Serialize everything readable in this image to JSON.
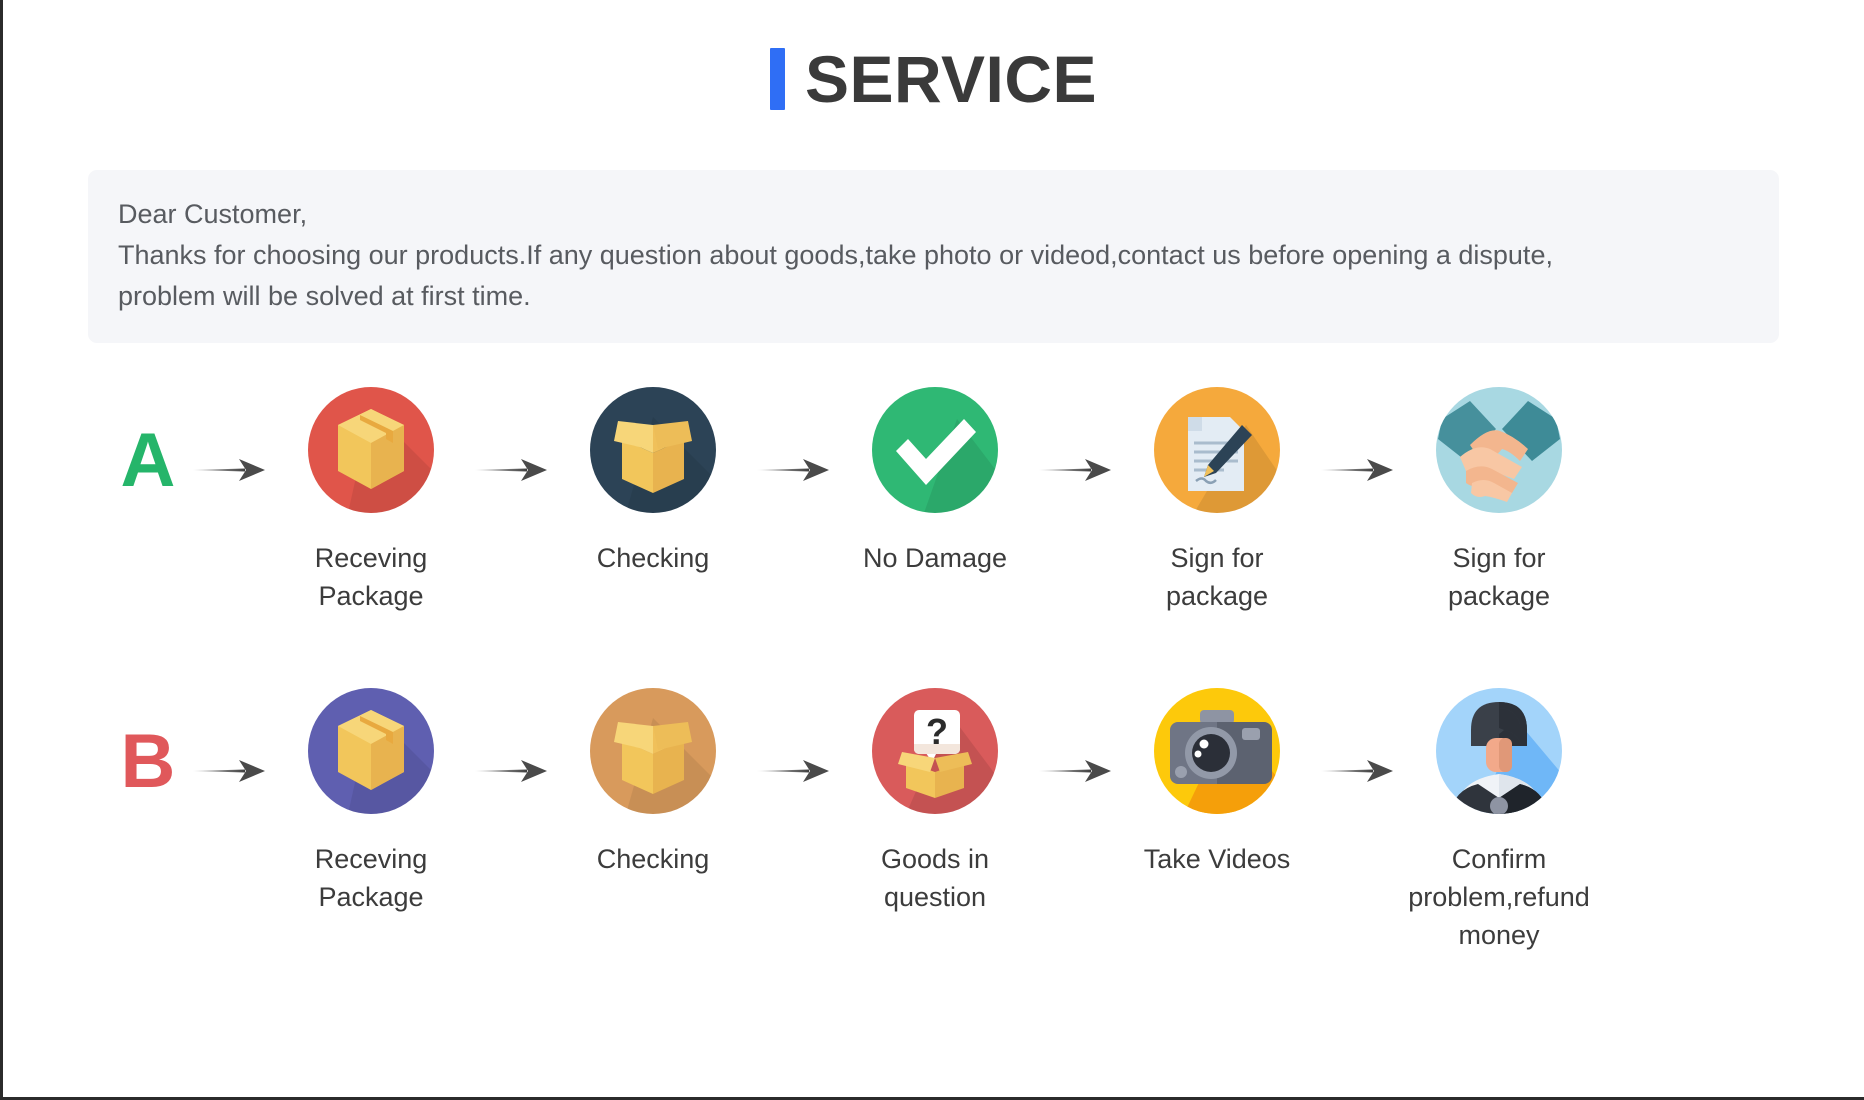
{
  "header": {
    "accent_color": "#2f6ef5",
    "title": "SERVICE"
  },
  "notice": {
    "line1": "Dear Customer,",
    "line2": "Thanks for choosing our products.If any question about goods,take photo or videod,contact us before opening a dispute,",
    "line3": "problem will be solved at first time.",
    "background": "#f5f6f9"
  },
  "flows": [
    {
      "letter": "A",
      "letter_color": "#25b56a",
      "steps": [
        {
          "icon": "package-box-icon",
          "circle": "#e0554a",
          "label": "Receving Package"
        },
        {
          "icon": "open-box-icon",
          "circle": "#2c4356",
          "label": "Checking"
        },
        {
          "icon": "checkmark-icon",
          "circle": "#2fb874",
          "label": "No Damage"
        },
        {
          "icon": "document-pen-icon",
          "circle": "#f5a93c",
          "label": "Sign for package"
        },
        {
          "icon": "handshake-icon",
          "circle": "#a8d8e2",
          "label": "Sign for package"
        }
      ]
    },
    {
      "letter": "B",
      "letter_color": "#e0585b",
      "steps": [
        {
          "icon": "package-box-icon",
          "circle": "#5f5fb0",
          "label": "Receving Package"
        },
        {
          "icon": "open-box-icon",
          "circle": "#d89a5c",
          "label": "Checking"
        },
        {
          "icon": "question-box-icon",
          "circle": "#d95b5b",
          "label": "Goods in question"
        },
        {
          "icon": "camera-icon",
          "circle": "#fdc90b",
          "label": "Take Videos"
        },
        {
          "icon": "support-person-icon",
          "circle": "#a3d4fa",
          "label": "Confirm problem,refund money"
        }
      ]
    }
  ],
  "arrow": {
    "name": "arrow-right-icon",
    "color": "#4a4a4a"
  }
}
